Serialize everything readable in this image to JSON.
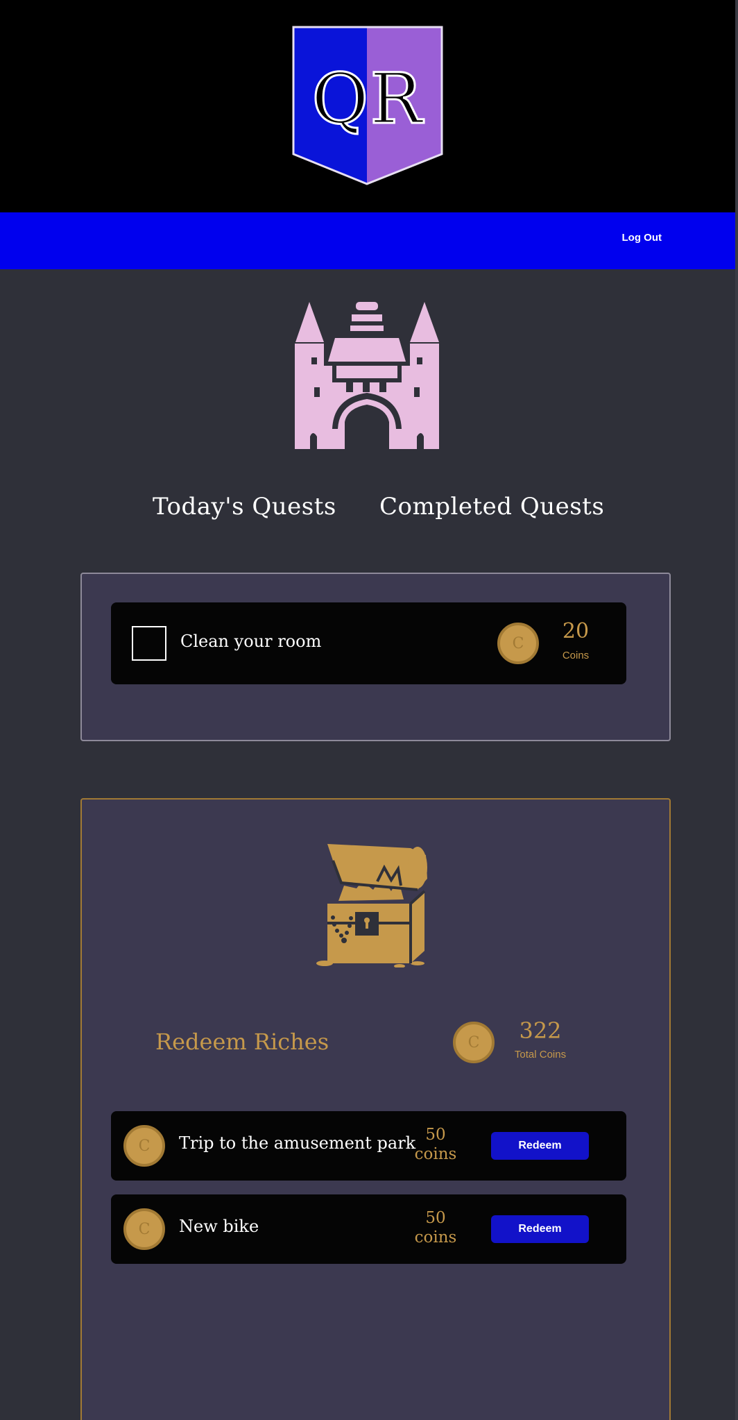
{
  "logo": {
    "text": "QR",
    "left_color": "#0a14d9",
    "right_color": "#9a5fd6"
  },
  "navbar": {
    "logout_label": "Log Out",
    "color": "#0000ee"
  },
  "tabs": [
    {
      "label": "Today's Quests"
    },
    {
      "label": "Completed Quests"
    }
  ],
  "quests": [
    {
      "name": "Clean your room",
      "reward": "20",
      "reward_label": "Coins",
      "checked": false
    }
  ],
  "riches": {
    "title": "Redeem Riches",
    "total_value": "322",
    "total_label": "Total Coins",
    "rewards": [
      {
        "name": "Trip to the amusement park",
        "cost_value": "50",
        "cost_unit": "coins",
        "button_label": "Redeem"
      },
      {
        "name": "New bike",
        "cost_value": "50",
        "cost_unit": "coins",
        "button_label": "Redeem"
      }
    ]
  },
  "icons": {
    "castle": "castle-icon",
    "chest": "treasure-chest-icon",
    "coin": "coin-icon"
  },
  "colors": {
    "gold": "#c6994b",
    "castle_pink": "#e8bde0",
    "panel_bg": "#3c3950"
  }
}
